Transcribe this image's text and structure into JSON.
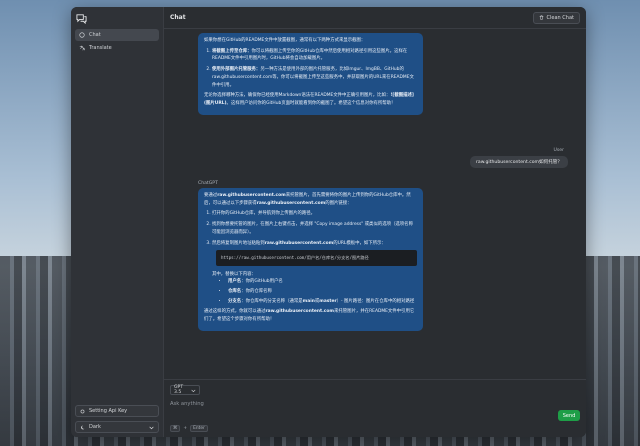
{
  "app": {
    "header_title": "Chat",
    "clear_label": "Clean Chat"
  },
  "sidebar": {
    "items": [
      {
        "label": "Chat",
        "icon": "chat-icon"
      },
      {
        "label": "Translate",
        "icon": "translate-icon"
      }
    ],
    "api_key_label": "Setting Api Key",
    "theme_label": "Dark"
  },
  "messages": {
    "assistant1": {
      "intro": "如果你想在GitHub的README文件中放置截图，通常有以下两种方式来显示截图：",
      "item1_bold": "将截图上传至仓库：",
      "item1_text": "你可以将截图上传至你的GitHub仓库中然后使用相对路径引用这些图片。这样在README文件中引用图片时，GitHub将会自动加载图片。",
      "item2_bold": "使用外部图片托管服务：",
      "item2_text": "另一种方法是使用外部的图片托管服务，比如Imgur、ImgBB、GitHub的raw.githubusercontent.com等，你可以将截图上传至这些服务中，并获取图片的URL来在README文件中引用。",
      "outro_a": "无论你选择哪种方法，确保你已经使用Markdown语法在README文件中正确引用图片，比如：",
      "outro_code": "![截图描述](图片URL)",
      "outro_b": "。这样用户访问你的GitHub页面时就能看到你的截图了。希望这个信息对你有所帮助！"
    },
    "user_role": "User",
    "user1": "raw.githubusercontent.com如何托管？",
    "assistant_role": "ChatGPT",
    "assistant2": {
      "intro_a": "要通过",
      "intro_code1": "raw.githubusercontent.com",
      "intro_b": "来托管图片，首先需要将你的图片上传到你的GitHub仓库中。然后，可以通过以下步骤获得",
      "intro_code2": "raw.githubusercontent.com",
      "intro_c": "的图片链接：",
      "step1": "打开你的GitHub仓库，并导航到你上传图片的路径。",
      "step2": "找到你想要托管的图片，在图片上右键点击，并选择 \"Copy image address\" 或类似的选项（选项名称可能因浏览器而异）。",
      "step3_a": "然后将复制图片地址粘贴到",
      "step3_code": "raw.githubusercontent.com",
      "step3_b": "的URL模板中，如下所示：",
      "code_block": "https://raw.githubusercontent.com/用户名/仓库名/分支名/图片路径",
      "replace_label": "其中，替换以下内容：",
      "rep1_code": "用户名",
      "rep1_text": "：你的GitHub用户名",
      "rep2_code": "仓库名",
      "rep2_text": "：你的仓库名称",
      "rep3_code": "分支名",
      "rep3_text_a": "：你仓库中的分支名称（通常是",
      "rep3_code2": "main",
      "rep3_text_b": "或",
      "rep3_code3": "master",
      "rep3_text_c": "）- 图片路径",
      "rep3_text_d": "：图片在仓库中的相对路径",
      "outro_a": "通过这样的方式，你就可以通过",
      "outro_code": "raw.githubusercontent.com",
      "outro_b": "来托管图片，并在README文件中引用它们了。希望这个步骤对你有所帮助！"
    }
  },
  "composer": {
    "model": "GPT 3.5",
    "placeholder": "Ask anything",
    "send_label": "Send",
    "hint_key1": "⌘",
    "hint_key2": "Enter",
    "hint_plus": "+"
  }
}
